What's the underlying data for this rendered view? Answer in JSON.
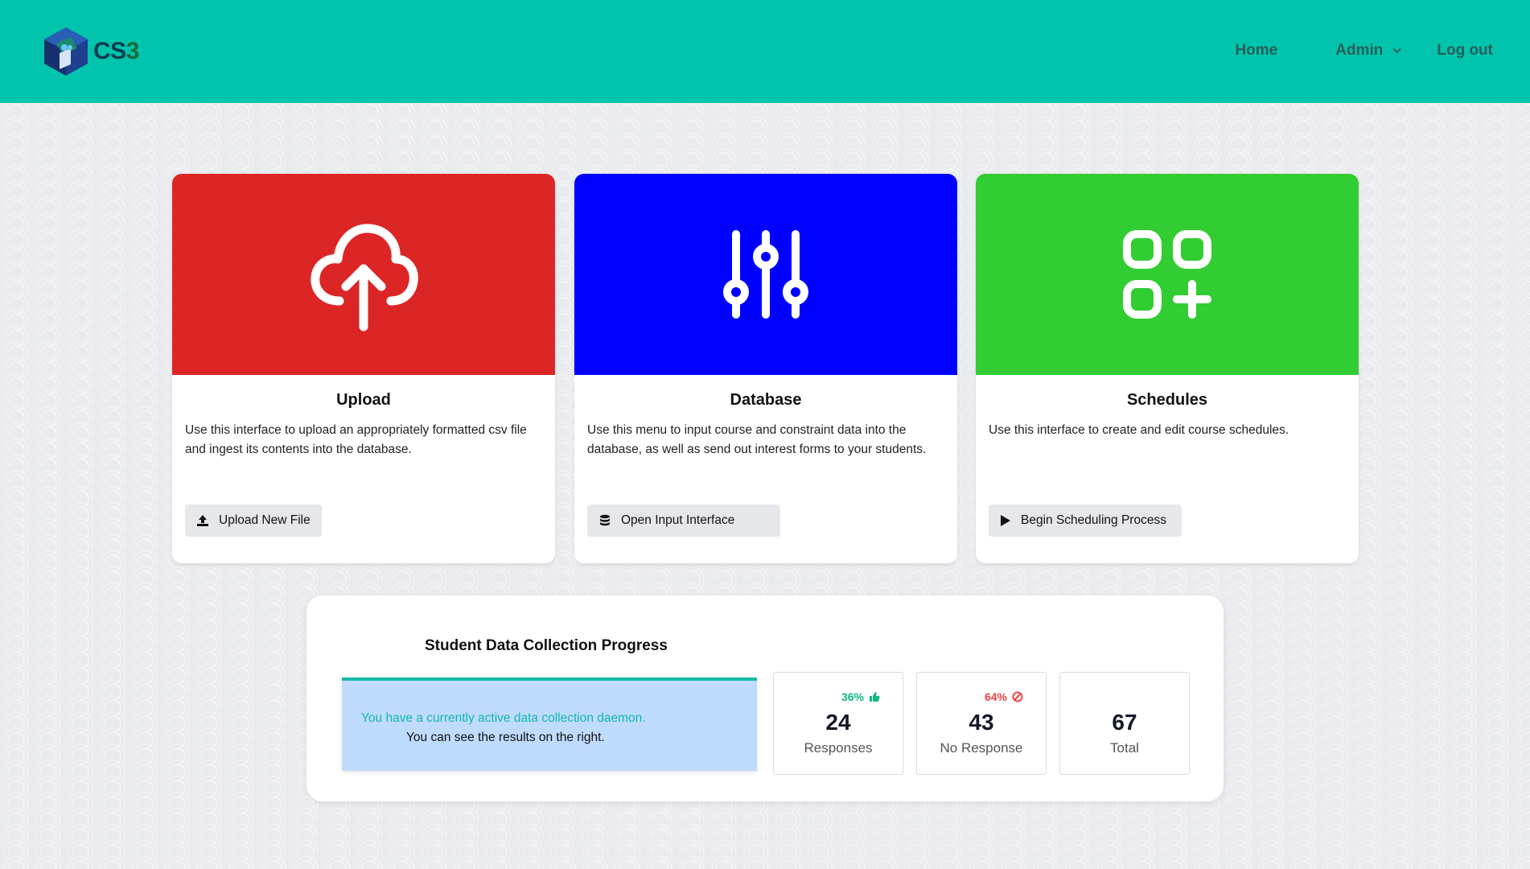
{
  "header": {
    "logo_text_a": "CS",
    "logo_text_b": "3",
    "nav": {
      "home": "Home",
      "admin": "Admin",
      "logout": "Log out"
    },
    "color": "#02c4ac"
  },
  "cards": [
    {
      "title": "Upload",
      "description": "Use this interface to upload an appropriately formatted csv file and ingest its contents into the database.",
      "button": "Upload New File",
      "icon": "cloud-upload-icon",
      "color": "#dc2626"
    },
    {
      "title": "Database",
      "description": "Use this menu to input course and constraint data into the database, as well as send out interest forms to your students.",
      "button": "Open Input Interface",
      "icon": "sliders-icon",
      "color": "#0000ff"
    },
    {
      "title": "Schedules",
      "description": "Use this interface to create and edit course schedules.",
      "button": "Begin Scheduling Process",
      "icon": "apps-add-icon",
      "color": "#32cd32"
    }
  ],
  "progress": {
    "title": "Student Data Collection Progress",
    "daemon_line1": "You have a currently active data collection daemon.",
    "daemon_line2": "You can see the results on the right.",
    "stats": [
      {
        "pct": "36%",
        "value": "24",
        "label": "Responses",
        "pct_color": "#10b981",
        "icon": "thumbs-up-icon"
      },
      {
        "pct": "64%",
        "value": "43",
        "label": "No Response",
        "pct_color": "#ef4444",
        "icon": "ban-icon"
      },
      {
        "pct": "",
        "value": "67",
        "label": "Total",
        "pct_color": "#111111",
        "icon": ""
      }
    ]
  }
}
